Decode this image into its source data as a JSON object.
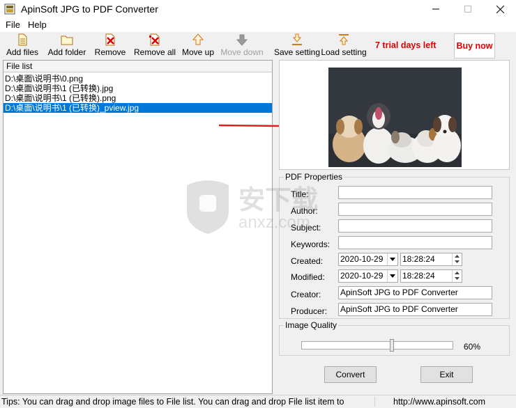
{
  "window": {
    "title": "ApinSoft JPG to PDF Converter"
  },
  "menu": {
    "items": [
      "File",
      "Help"
    ]
  },
  "toolbar": {
    "add_files": "Add files",
    "add_folder": "Add folder",
    "remove": "Remove",
    "remove_all": "Remove all",
    "move_up": "Move up",
    "move_down": "Move down",
    "save_setting": "Save setting",
    "load_setting": "Load setting",
    "trial": "7 trial days left",
    "buy": "Buy now"
  },
  "file_list": {
    "header": "File list",
    "files": [
      "D:\\桌面\\说明书\\0.png",
      "D:\\桌面\\说明书\\1 (已转换).jpg",
      "D:\\桌面\\说明书\\1 (已转换).png",
      "D:\\桌面\\说明书\\1 (已转换)_pview.jpg"
    ],
    "selected_index": 3
  },
  "pdf_properties": {
    "group_title": "PDF Properties",
    "title_label": "Title:",
    "title_value": "",
    "author_label": "Author:",
    "author_value": "",
    "subject_label": "Subject:",
    "subject_value": "",
    "keywords_label": "Keywords:",
    "keywords_value": "",
    "created_label": "Created:",
    "created_date": "2020-10-29",
    "created_time": "18:28:24",
    "modified_label": "Modified:",
    "modified_date": "2020-10-29",
    "modified_time": "18:28:24",
    "creator_label": "Creator:",
    "creator_value": "ApinSoft JPG to PDF Converter",
    "producer_label": "Producer:",
    "producer_value": "ApinSoft JPG to PDF Converter"
  },
  "image_quality": {
    "group_title": "Image Quality",
    "value_text": "60%",
    "value": 0.6
  },
  "buttons": {
    "convert": "Convert",
    "exit": "Exit"
  },
  "status": {
    "tip": "Tips: You can drag and drop image files to File list. You can drag and drop File list item to",
    "url": "http://www.apinsoft.com"
  },
  "watermark": {
    "text": "安下载",
    "sub": "anxz.com"
  },
  "colors": {
    "accent_red": "#e00000",
    "selection": "#0078d7"
  }
}
